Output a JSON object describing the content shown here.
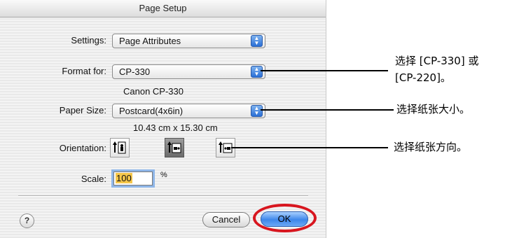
{
  "window": {
    "title": "Page Setup"
  },
  "settings": {
    "label": "Settings:",
    "value": "Page Attributes"
  },
  "format_for": {
    "label": "Format for:",
    "value": "CP-330",
    "printer_name": "Canon CP-330"
  },
  "paper_size": {
    "label": "Paper Size:",
    "value": "Postcard(4x6in)",
    "dimensions": "10.43 cm x 15.30 cm"
  },
  "orientation": {
    "label": "Orientation:",
    "selected": "landscape-left"
  },
  "scale": {
    "label": "Scale:",
    "value": "100",
    "unit": "%"
  },
  "buttons": {
    "help": "?",
    "cancel": "Cancel",
    "ok": "OK"
  },
  "callouts": {
    "format_line1": "选择 [CP-330] 或",
    "format_line2": "[CP-220]。",
    "paper": "选择纸张大小。",
    "orientation": "选择纸张方向。"
  },
  "colors": {
    "highlight_ring": "#d8161f",
    "accent": "#3d86ea"
  }
}
